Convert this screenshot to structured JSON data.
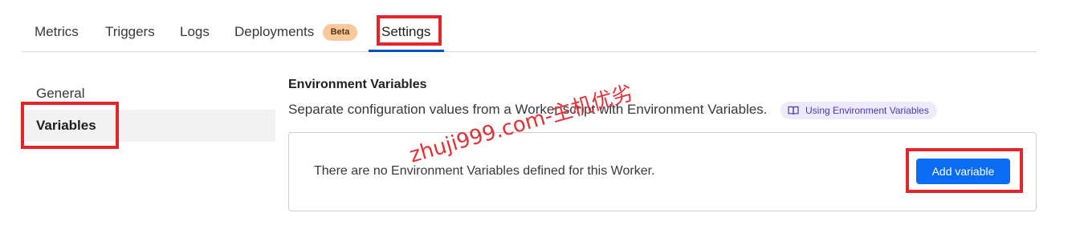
{
  "tabs": [
    {
      "label": "Metrics"
    },
    {
      "label": "Triggers"
    },
    {
      "label": "Logs"
    },
    {
      "label": "Deployments",
      "badge": "Beta"
    },
    {
      "label": "Settings",
      "active": true
    }
  ],
  "subnav": {
    "general": "General",
    "variables": "Variables",
    "active": "Variables"
  },
  "env_vars": {
    "title": "Environment Variables",
    "description": "Separate configuration values from a Worker script with Environment Variables.",
    "doc_link": "Using Environment Variables",
    "doc_icon": "book-icon",
    "empty_message": "There are no Environment Variables defined for this Worker.",
    "add_button": "Add variable"
  },
  "watermark": "zhuji999.com-主机优劣",
  "colors": {
    "accent": "#0a6cf5",
    "highlight": "#e3242b",
    "beta_badge": "#f7c99b"
  }
}
